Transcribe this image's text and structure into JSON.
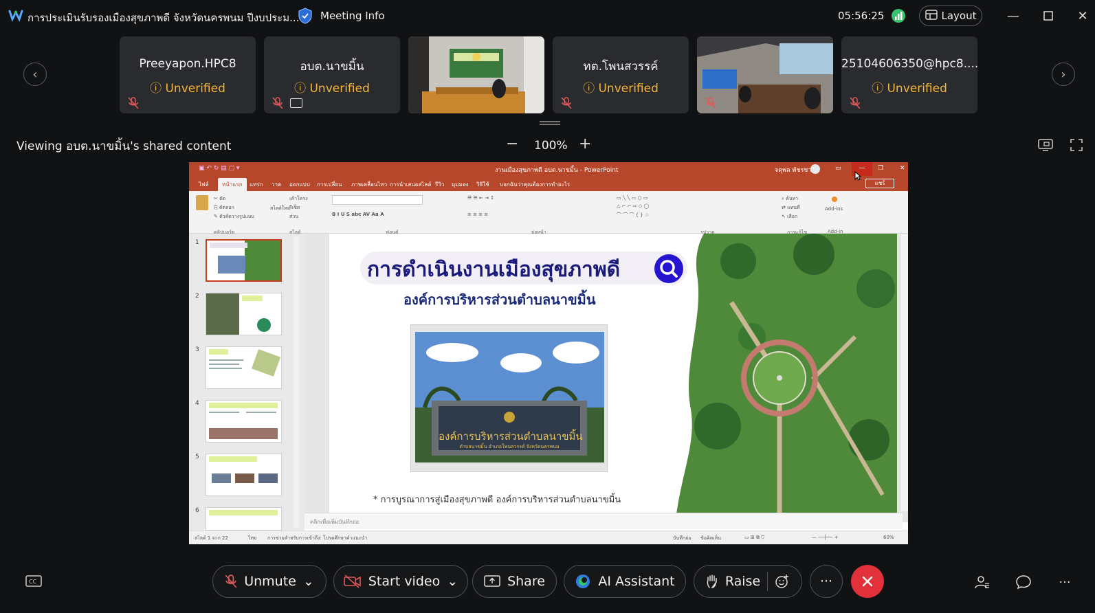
{
  "titlebar": {
    "app_title": "การประเมินรับรองเมืองสุขภาพดี จังหวัดนครพนม ปีงบประม...",
    "meeting_info": "Meeting Info",
    "timer": "05:56:25",
    "layout_label": "Layout"
  },
  "participants": [
    {
      "name": "Preeyapon.HPC8",
      "status": "Unverified"
    },
    {
      "name": "อบต.นาขมิ้น",
      "status": "Unverified"
    },
    {
      "name": "",
      "status": ""
    },
    {
      "name": "ทต.โพนสวรรค์",
      "status": "Unverified"
    },
    {
      "name": "",
      "status": ""
    },
    {
      "name": "25104606350@hpc8....",
      "status": "Unverified"
    }
  ],
  "viewing": {
    "label": "Viewing อบต.นาขมิ้น's shared content",
    "zoom": "100%"
  },
  "powerpoint": {
    "window_title": "งานเมืองสุขภาพดี อบต.นาขมิ้น - PowerPoint",
    "user": "จตุพล พัชรชาย",
    "tabs": [
      "ไฟล์",
      "หน้าแรก",
      "แทรก",
      "วาด",
      "ออกแบบ",
      "การเปลี่ยน",
      "ภาพเคลื่อนไหว",
      "การนำเสนอสไลด์",
      "รีวิว",
      "มุมมอง",
      "วิธีใช้",
      "บอกฉันว่าคุณต้องการทำอะไร"
    ],
    "share_label": "แชร์",
    "ribbon_groups": [
      "คลิปบอร์ด",
      "สไลด์",
      "ฟอนต์",
      "ย่อหน้า",
      "รูปวาด",
      "การแก้ไข",
      "Add-in"
    ],
    "ribbon_items": {
      "cut": "ตัด",
      "copy": "คัดลอก",
      "format_painter": "ตัวคัดวางรูปแบบ",
      "new_slide": "สไลด์ใหม่",
      "layout": "เค้าโครง",
      "reset": "รีเซ็ต",
      "section": "ส่วน",
      "find": "ค้นหา",
      "replace": "แทนที่",
      "select": "เลือก",
      "addins": "Add-ins"
    },
    "slide_numbers": [
      "1",
      "2",
      "3",
      "4",
      "5",
      "6"
    ],
    "slide": {
      "title": "การดำเนินงานเมืองสุขภาพดี",
      "subtitle": "องค์การบริหารส่วนตำบลนาขมิ้น",
      "sign_text": "องค์การบริหารส่วนตำบลนาขมิ้น",
      "sign_sub": "ตำบลนาขมิ้น อำเภอโพนสวรรค์ จังหวัดนครพนม",
      "bullet": "* การบูรณาการสู่เมืองสุขภาพดี องค์การบริหารส่วนตำบลนาขมิ้น"
    },
    "notes_placeholder": "คลิกเพื่อเพิ่มบันทึกย่อ",
    "status": {
      "slide_count": "สไลด์ 1 จาก 22",
      "language": "ไทย",
      "accessibility": "การช่วยสำหรับการเข้าถึง: โปรดศึกษาคำแนะนำ",
      "notes": "บันทึกย่อ",
      "comments": "ข้อคิดเห็น",
      "zoom": "60%"
    }
  },
  "toolbar": {
    "unmute": "Unmute",
    "start_video": "Start video",
    "share": "Share",
    "ai_assistant": "AI Assistant",
    "raise": "Raise",
    "more": "···"
  },
  "colors": {
    "accent_orange": "#f4b63a",
    "end_red": "#e3313b",
    "mic_red": "#e05a5a",
    "ppt_red": "#b7472a",
    "signal_green": "#36c46d"
  }
}
